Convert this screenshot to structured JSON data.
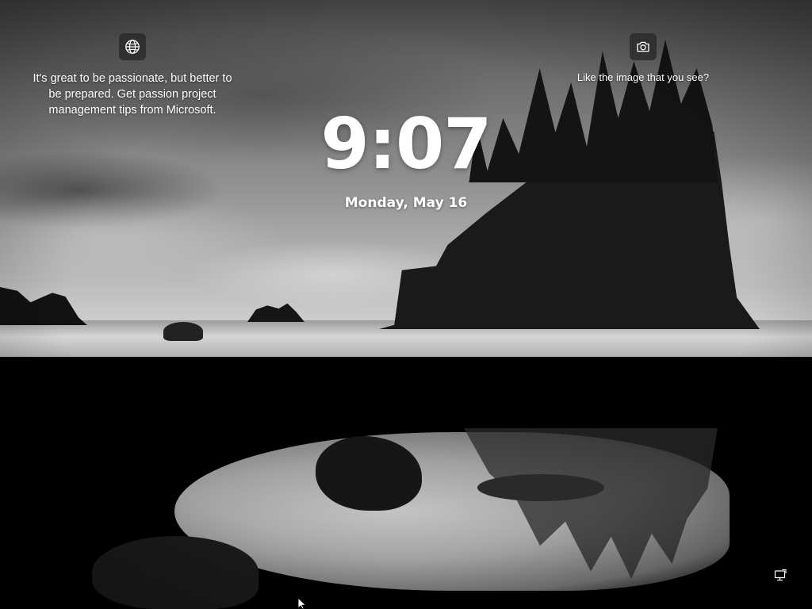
{
  "spotlight": {
    "info_icon": "globe-icon",
    "description": "It's great to be passionate, but better to be prepared. Get passion project management tips from Microsoft.",
    "camera_icon": "camera-icon",
    "like_prompt": "Like the image that you see?"
  },
  "clock": {
    "time": "9:07",
    "date": "Monday, May 16"
  },
  "system_tray": {
    "network_icon": "network-icon"
  },
  "colors": {
    "text": "#ffffff",
    "icon_button_bg": "#282828"
  }
}
